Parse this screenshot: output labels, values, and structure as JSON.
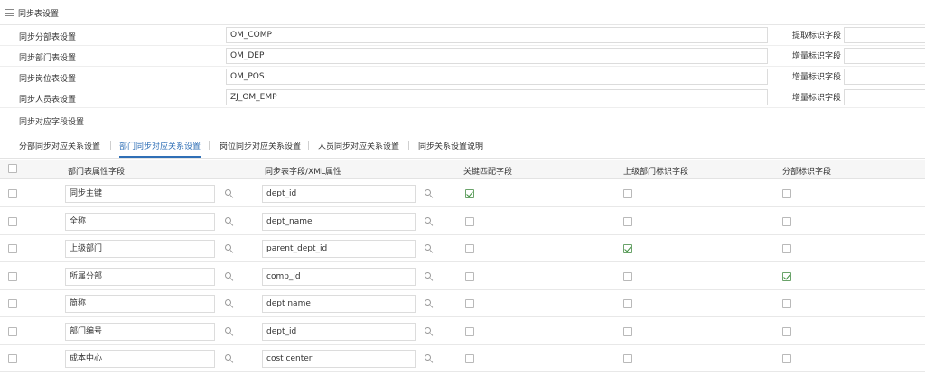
{
  "header": {
    "title": "同步表设置"
  },
  "table_settings": [
    {
      "label": "同步分部表设置",
      "value": "OM_COMP",
      "flag_label": "提取标识字段"
    },
    {
      "label": "同步部门表设置",
      "value": "OM_DEP",
      "flag_label": "增量标识字段"
    },
    {
      "label": "同步岗位表设置",
      "value": "OM_POS",
      "flag_label": "增量标识字段"
    },
    {
      "label": "同步人员表设置",
      "value": "ZJ_OM_EMP",
      "flag_label": "增量标识字段"
    }
  ],
  "field_section_title": "同步对应字段设置",
  "tabs": [
    {
      "label": "分部同步对应关系设置",
      "active": false
    },
    {
      "label": "部门同步对应关系设置",
      "active": true
    },
    {
      "label": "岗位同步对应关系设置",
      "active": false
    },
    {
      "label": "人员同步对应关系设置",
      "active": false
    },
    {
      "label": "同步关系设置说明",
      "active": false
    }
  ],
  "grid": {
    "columns": [
      "部门表属性字段",
      "同步表字段/XML属性",
      "关键匹配字段",
      "上级部门标识字段",
      "分部标识字段"
    ],
    "rows": [
      {
        "attr": "同步主键",
        "field": "dept_id",
        "key": true,
        "parent": false,
        "comp": false
      },
      {
        "attr": "全称",
        "field": "dept_name",
        "key": false,
        "parent": false,
        "comp": false
      },
      {
        "attr": "上级部门",
        "field": "parent_dept_id",
        "key": false,
        "parent": true,
        "comp": false
      },
      {
        "attr": "所属分部",
        "field": "comp_id",
        "key": false,
        "parent": false,
        "comp": true
      },
      {
        "attr": "简称",
        "field": "dept name",
        "key": false,
        "parent": false,
        "comp": false
      },
      {
        "attr": "部门编号",
        "field": "dept_id",
        "key": false,
        "parent": false,
        "comp": false
      },
      {
        "attr": "成本中心",
        "field": "cost center",
        "key": false,
        "parent": false,
        "comp": false
      }
    ]
  },
  "colors": {
    "accent": "#2f6fb6",
    "check": "#3d8f3d",
    "border": "#dcdcdc"
  }
}
